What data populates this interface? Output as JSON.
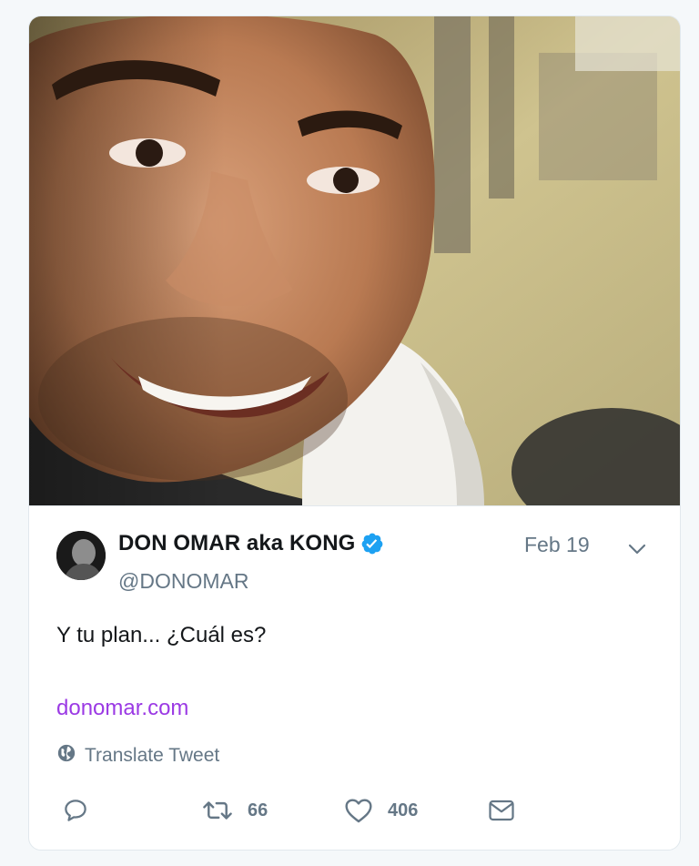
{
  "tweet": {
    "author": {
      "display_name": "DON OMAR aka KONG",
      "handle": "@DONOMAR",
      "verified": true,
      "verified_color": "#1da1f2"
    },
    "date": "Feb 19",
    "text": "Y tu plan... ¿Cuál es?",
    "link": "donomar.com",
    "link_color": "#9b3ae4",
    "translate_label": "Translate Tweet",
    "actions": {
      "reply_icon": "reply-icon",
      "retweet_count": "66",
      "like_count": "406",
      "dm_icon": "envelope-icon"
    }
  }
}
